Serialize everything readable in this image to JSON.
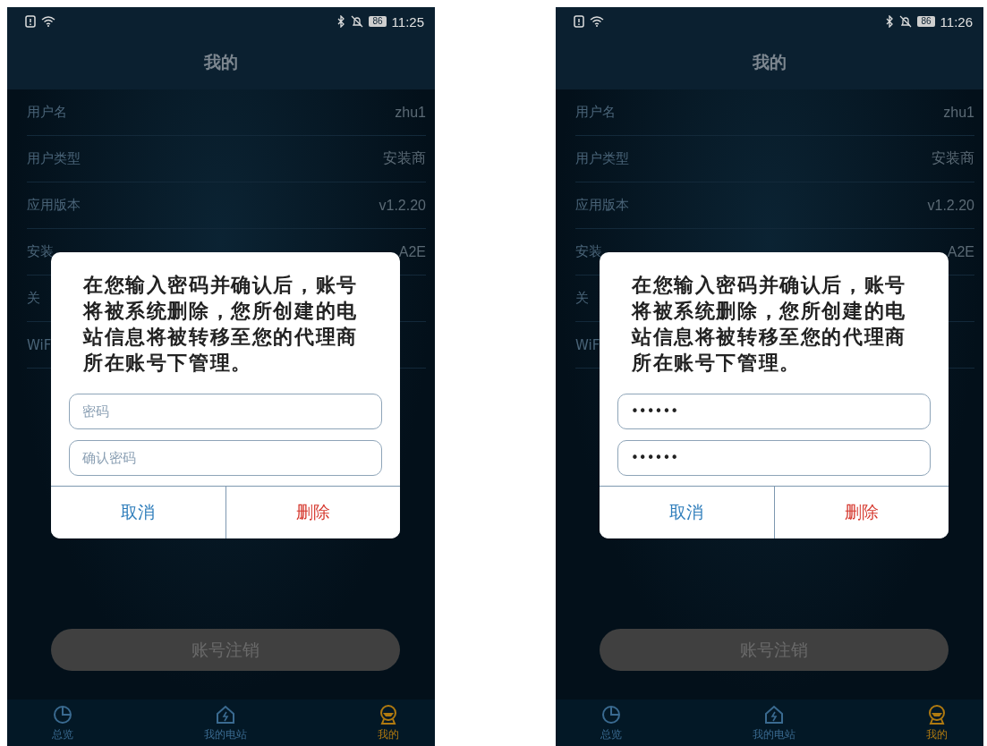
{
  "screens": [
    {
      "status_bar": {
        "battery": "86",
        "time": "11:25"
      },
      "title": "我的",
      "rows": [
        {
          "label": "用户名",
          "value": "zhu1"
        },
        {
          "label": "用户类型",
          "value": "安装商"
        },
        {
          "label": "应用版本",
          "value": "v1.2.20"
        },
        {
          "label": "安装",
          "value": "A2E"
        },
        {
          "label": "关"
        },
        {
          "label": "WiF"
        }
      ],
      "dialog": {
        "message": "在您输入密码并确认后，账号将被系统删除，您所创建的电站信息将被转移至您的代理商所在账号下管理。",
        "fields": [
          {
            "placeholder": "密码"
          },
          {
            "placeholder": "确认密码"
          }
        ],
        "buttons": [
          {
            "label": "取消",
            "kind": "cancel"
          },
          {
            "label": "删除",
            "kind": "delete"
          }
        ]
      },
      "action_button": {
        "label": "账号注销"
      },
      "nav": [
        {
          "label": "总览",
          "kind": "overview",
          "selected": false
        },
        {
          "label": "我的电站",
          "kind": "station",
          "selected": false
        },
        {
          "label": "我的",
          "kind": "me",
          "selected": true
        }
      ]
    },
    {
      "status_bar": {
        "battery": "86",
        "time": "11:26"
      },
      "title": "我的",
      "rows": [
        {
          "label": "用户名",
          "value": "zhu1"
        },
        {
          "label": "用户类型",
          "value": "安装商"
        },
        {
          "label": "应用版本",
          "value": "v1.2.20"
        },
        {
          "label": "安装",
          "value": "A2E"
        },
        {
          "label": "关"
        },
        {
          "label": "WiF"
        }
      ],
      "dialog": {
        "message": "在您输入密码并确认后，账号将被系统删除，您所创建的电站信息将被转移至您的代理商所在账号下管理。",
        "fields": [
          {
            "value": "••••••"
          },
          {
            "value": "••••••"
          }
        ],
        "buttons": [
          {
            "label": "取消",
            "kind": "cancel"
          },
          {
            "label": "删除",
            "kind": "delete"
          }
        ]
      },
      "action_button": {
        "label": "账号注销"
      },
      "nav": [
        {
          "label": "总览",
          "kind": "overview",
          "selected": false
        },
        {
          "label": "我的电站",
          "kind": "station",
          "selected": false
        },
        {
          "label": "我的",
          "kind": "me",
          "selected": true
        }
      ]
    }
  ]
}
